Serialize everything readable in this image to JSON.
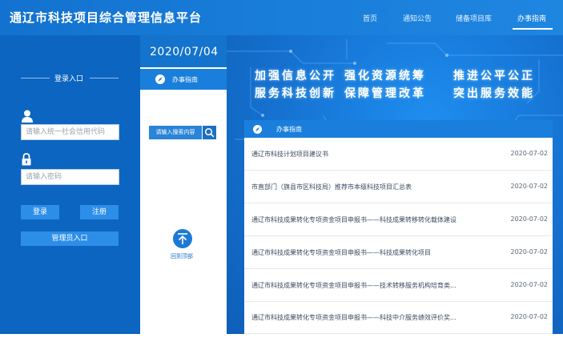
{
  "header": {
    "site_title": "通辽市科技项目综合管理信息平台",
    "nav": [
      {
        "label": "首页"
      },
      {
        "label": "通知公告"
      },
      {
        "label": "储备项目库"
      },
      {
        "label": "办事指南"
      }
    ],
    "active_nav": "办事指南"
  },
  "login": {
    "heading": "登录入口",
    "code_placeholder": "请输入统一社会信用代码",
    "password_placeholder": "请输入密码",
    "login_label": "登录",
    "register_label": "注册",
    "admin_label": "管理员入口"
  },
  "sidebar": {
    "date": "2020/07/04",
    "guide_tab_label": "办事指南",
    "search_placeholder": "请输入搜索内容",
    "back_to_top": "回到顶部"
  },
  "banner": {
    "slogans": [
      "加强信息公开",
      "强化资源统筹",
      "推进公平公正",
      "服务科技创新",
      "保障管理改革",
      "突出服务效能"
    ]
  },
  "guide": {
    "header": "办事指南",
    "rows": [
      {
        "title": "通辽市科技计划项目建议书",
        "date": "2020-07-02"
      },
      {
        "title": "市直部门（旗县市区科技局）推荐市本级科技项目汇总表",
        "date": "2020-07-02"
      },
      {
        "title": "通辽市科技成果转化专项资金项目申报书——科技成果转移转化载体建设",
        "date": "2020-07-02"
      },
      {
        "title": "通辽市科技成果转化专项资金项目申报书——科技成果转化项目",
        "date": "2020-07-02"
      },
      {
        "title": "通辽市科技成果转化专项资金项目申报书——技术转移服务机构培育类...",
        "date": "2020-07-02"
      },
      {
        "title": "通辽市科技成果转化专项资金项目申报书——科技中介服务绩效评价奖...",
        "date": "2020-07-02"
      }
    ]
  },
  "colors": {
    "brand_blue": "#1a7fdc",
    "panel_blue": "#0c65c0",
    "button_blue": "#2d8ee9"
  }
}
